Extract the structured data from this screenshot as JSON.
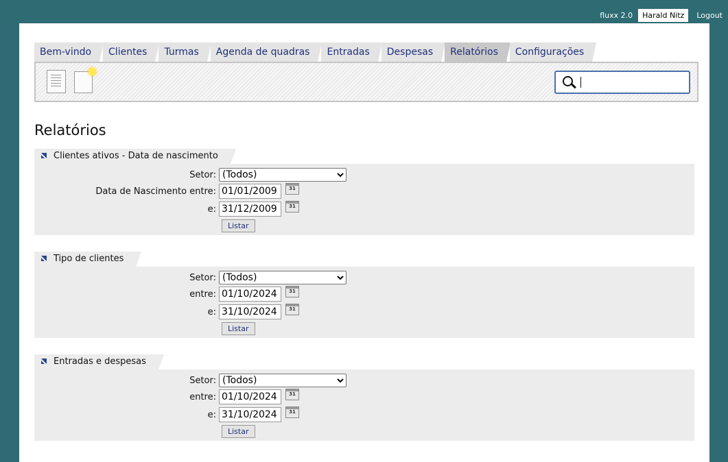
{
  "topbar": {
    "app_version": "fluxx 2.0",
    "user": "Harald Nitz",
    "logout": "Logout"
  },
  "tabs": [
    {
      "label": "Bem-vindo",
      "active": false
    },
    {
      "label": "Clientes",
      "active": false
    },
    {
      "label": "Turmas",
      "active": false
    },
    {
      "label": "Agenda de quadras",
      "active": false
    },
    {
      "label": "Entradas",
      "active": false
    },
    {
      "label": "Despesas",
      "active": false
    },
    {
      "label": "Relatórios",
      "active": true
    },
    {
      "label": "Configurações",
      "active": false
    }
  ],
  "toolbar": {
    "search_value": ""
  },
  "page": {
    "title": "Relatórios"
  },
  "sections": [
    {
      "title": "Clientes ativos - Data de nascimento",
      "setor_label": "Setor:",
      "setor_value": "(Todos)",
      "from_label": "Data de Nascimento entre:",
      "from_value": "01/01/2009",
      "to_label": "e:",
      "to_value": "31/12/2009",
      "button": "Listar"
    },
    {
      "title": "Tipo de clientes",
      "setor_label": "Setor:",
      "setor_value": "(Todos)",
      "from_label": "entre:",
      "from_value": "01/10/2024",
      "to_label": "e:",
      "to_value": "31/10/2024",
      "button": "Listar"
    },
    {
      "title": "Entradas e despesas",
      "setor_label": "Setor:",
      "setor_value": "(Todos)",
      "from_label": "entre:",
      "from_value": "01/10/2024",
      "to_label": "e:",
      "to_value": "31/10/2024",
      "button": "Listar"
    }
  ],
  "calendar_icon_text": "31",
  "colors": {
    "background": "#2e6b72",
    "tab_text": "#1f2f7a",
    "panel": "#ffffff",
    "section_bg": "#ececec"
  }
}
